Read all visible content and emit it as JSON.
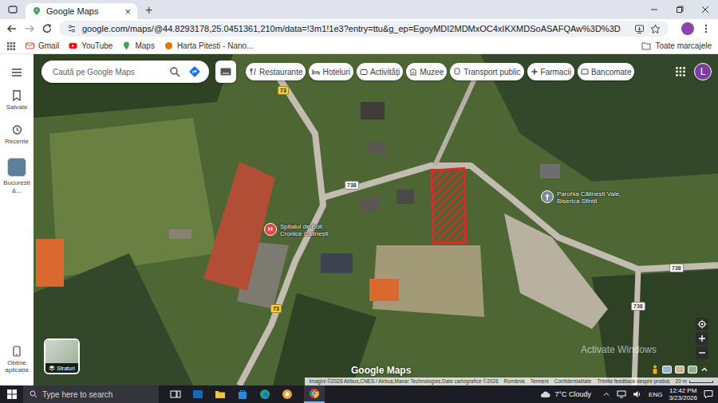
{
  "browser": {
    "tab": {
      "title": "Google Maps",
      "close": "×",
      "selected": true
    },
    "new_tab": "+",
    "url": "google.com/maps/@44.8293178,25.0451361,210m/data=!3m1!1e3?entry=ttu&g_ep=EgoyMDI2MDMxOC4xIKXMDSoASAFQAw%3D%3D",
    "bookmarks": [
      "Gmail",
      "YouTube",
      "Maps",
      "Harta Pitesti - Nano..."
    ],
    "all_bookmarks": "Toate marcajele"
  },
  "rail": {
    "items": [
      "Salvate",
      "Recente",
      "Bucuresti &..."
    ],
    "get_app": "Obține aplicația"
  },
  "search": {
    "placeholder": "Caută pe Google Maps"
  },
  "chips": [
    "Restaurante",
    "Hoteluri",
    "Activități",
    "Muzee",
    "Transport public",
    "Farmacii",
    "Bancomate"
  ],
  "avatar": "L",
  "map": {
    "places": [
      {
        "name": "Spitalul de Boli Cronice Călinești",
        "kind": "hospital",
        "glyph": "H",
        "color": "#e8453c"
      },
      {
        "name": "Parohia Călinești Vale, Biserica Sfinții",
        "kind": "church",
        "glyph": "",
        "color": "#7b8a97"
      }
    ],
    "route_labels": [
      {
        "text": "73",
        "kind": "national"
      },
      {
        "text": "73",
        "kind": "national"
      },
      {
        "text": "738",
        "kind": "county"
      },
      {
        "text": "738",
        "kind": "county"
      },
      {
        "text": "738",
        "kind": "county"
      }
    ],
    "watermark": "Google Maps",
    "layers": "Straturi"
  },
  "footer": {
    "attribution": "Imagini ©2026 Airbus,CNES / Airbus,Maxar Technologies,Date cartografice ©2026",
    "links": [
      "România",
      "Termeni",
      "Confidențialitate",
      "Trimite feedback despre produs"
    ],
    "scale": "20 m"
  },
  "activation": "Activate Windows",
  "taskbar": {
    "search_placeholder": "Type here to search",
    "weather": "7°C Cloudy",
    "language": "ENG",
    "time": "12:42 PM",
    "date": "3/23/2026"
  }
}
